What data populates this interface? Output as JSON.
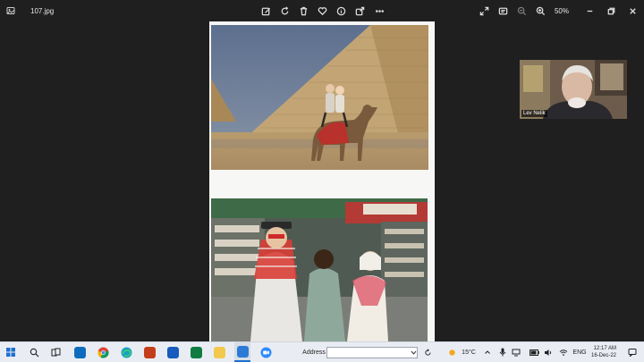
{
  "titlebar": {
    "file_name": "107.jpg",
    "zoom": "50%"
  },
  "video_call": {
    "participant_name": "Lev Nelik"
  },
  "taskbar": {
    "address_label": "Address",
    "temperature": "15°C",
    "language": "ENG",
    "time": "12:17 AM",
    "date": "16-Dec-22"
  }
}
